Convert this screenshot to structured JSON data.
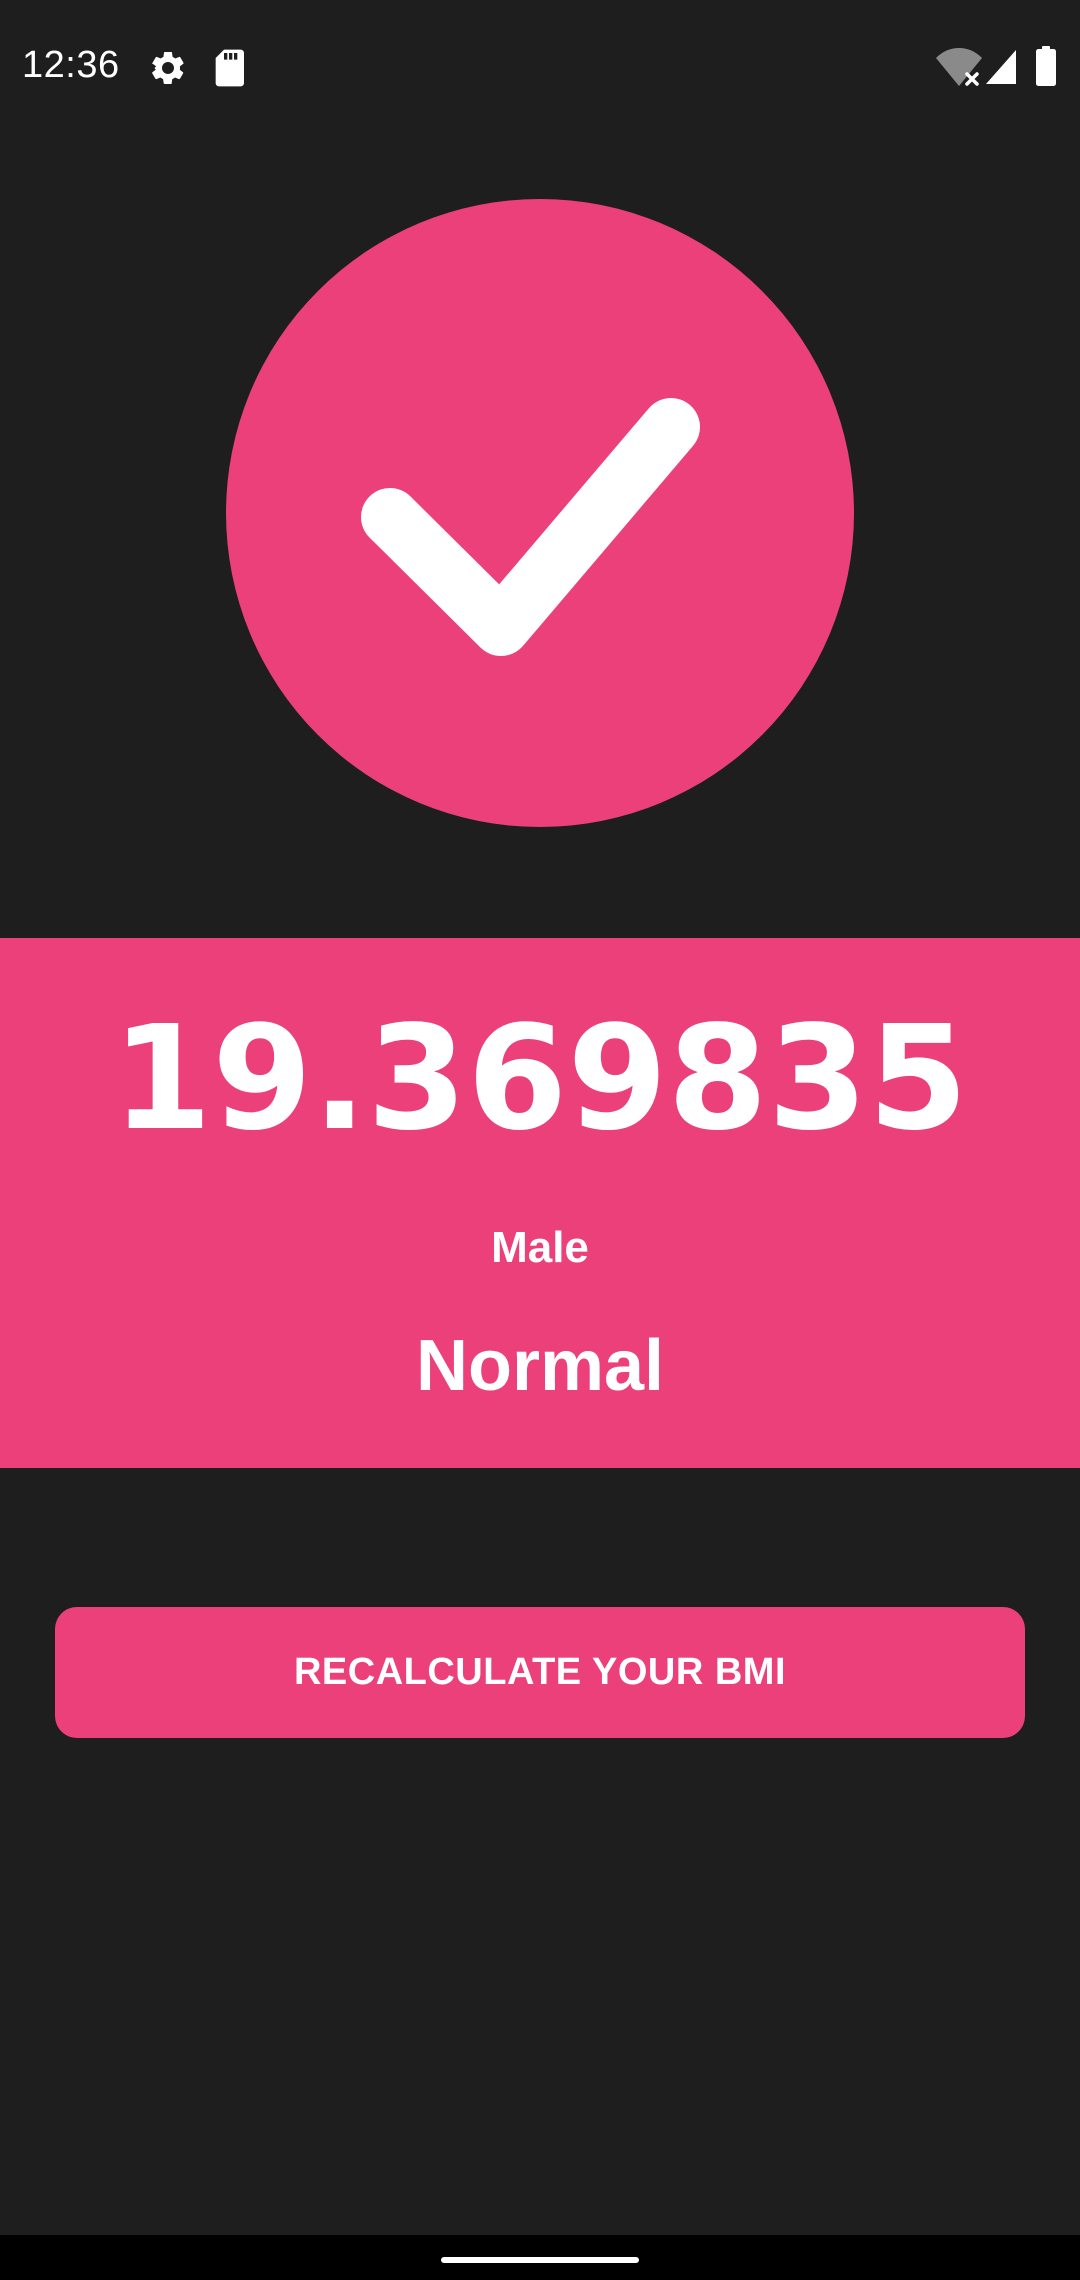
{
  "status_bar": {
    "time": "12:36",
    "icons": [
      "gear-icon",
      "sd-card-icon",
      "wifi-off-icon",
      "cell-signal-icon",
      "battery-icon"
    ]
  },
  "hero": {
    "icon": "check-icon",
    "circle_color": "#ec407a"
  },
  "result": {
    "bmi_value": "19.369835",
    "gender": "Male",
    "category": "Normal",
    "panel_color": "#ec407a"
  },
  "actions": {
    "recalculate_label": "RECALCULATE YOUR BMI"
  },
  "colors": {
    "background": "#1e1e1f",
    "accent": "#ec407a",
    "text": "#ffffff"
  }
}
